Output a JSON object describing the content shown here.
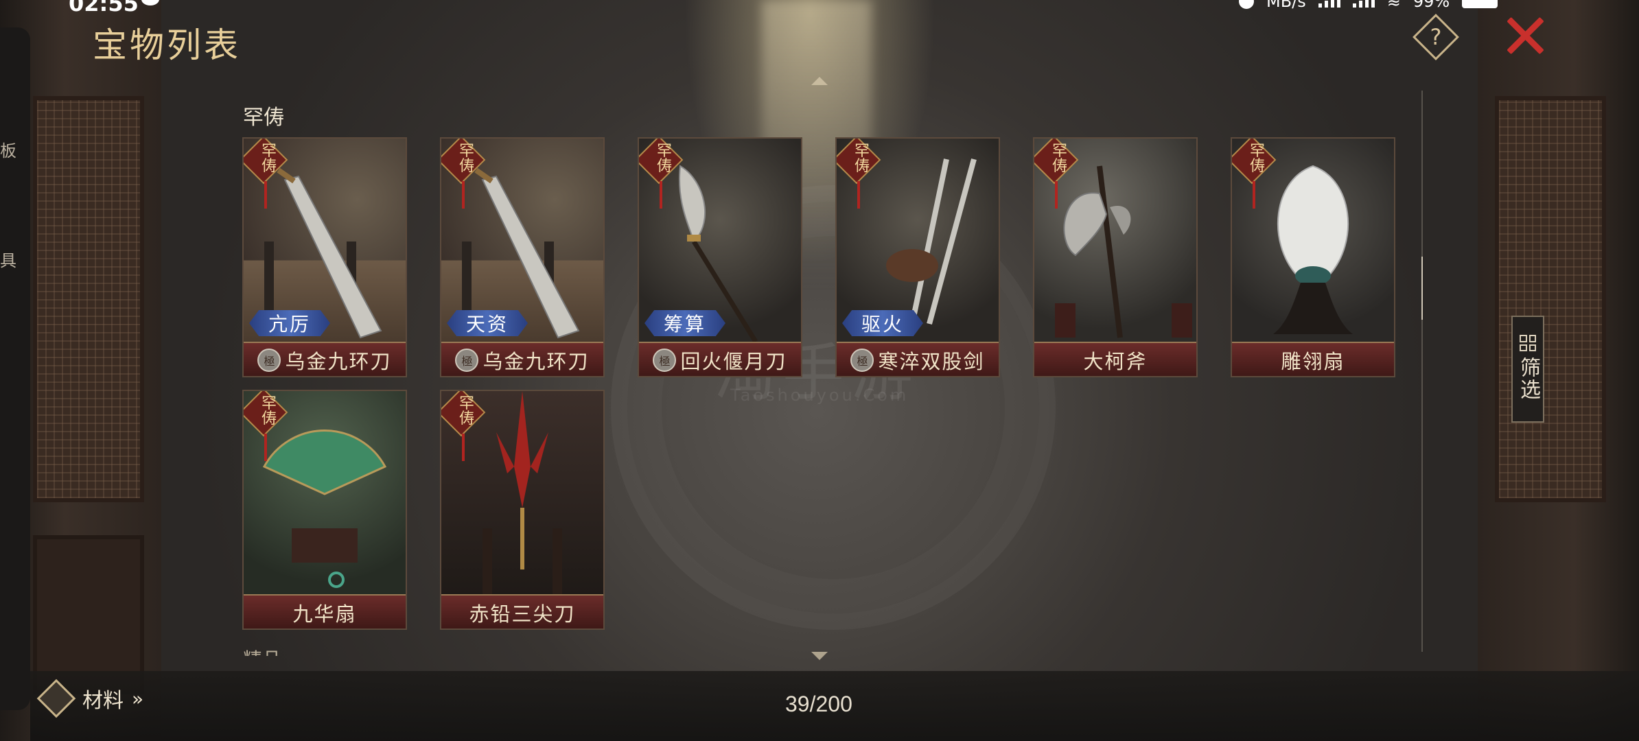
{
  "status_bar": {
    "time": "02:55",
    "network": "MB/s",
    "battery": "99%"
  },
  "header": {
    "title": "宝物列表",
    "help_label": "?"
  },
  "left_tab": {
    "chars": [
      "板",
      "具"
    ]
  },
  "section": {
    "label": "罕俦",
    "next_label": "精品"
  },
  "cards": [
    {
      "rarity": "罕俦",
      "skill": "亢厉",
      "name": "乌金九环刀",
      "grade": "極"
    },
    {
      "rarity": "罕俦",
      "skill": "天资",
      "name": "乌金九环刀",
      "grade": "極"
    },
    {
      "rarity": "罕俦",
      "skill": "筹算",
      "name": "回火偃月刀",
      "grade": "極"
    },
    {
      "rarity": "罕俦",
      "skill": "驱火",
      "name": "寒淬双股剑",
      "grade": "極"
    },
    {
      "rarity": "罕俦",
      "skill": "",
      "name": "大柯斧",
      "grade": ""
    },
    {
      "rarity": "罕俦",
      "skill": "",
      "name": "雕翎扇",
      "grade": ""
    },
    {
      "rarity": "罕俦",
      "skill": "",
      "name": "九华扇",
      "grade": ""
    },
    {
      "rarity": "罕俦",
      "skill": "",
      "name": "赤铅三尖刀",
      "grade": ""
    }
  ],
  "filter": {
    "label": "筛选"
  },
  "footer": {
    "materials_label": "材料",
    "materials_arrow": "»",
    "count": "39/200"
  },
  "watermark": {
    "main": "淘手游",
    "sub": "Taoshouyou.Com"
  }
}
